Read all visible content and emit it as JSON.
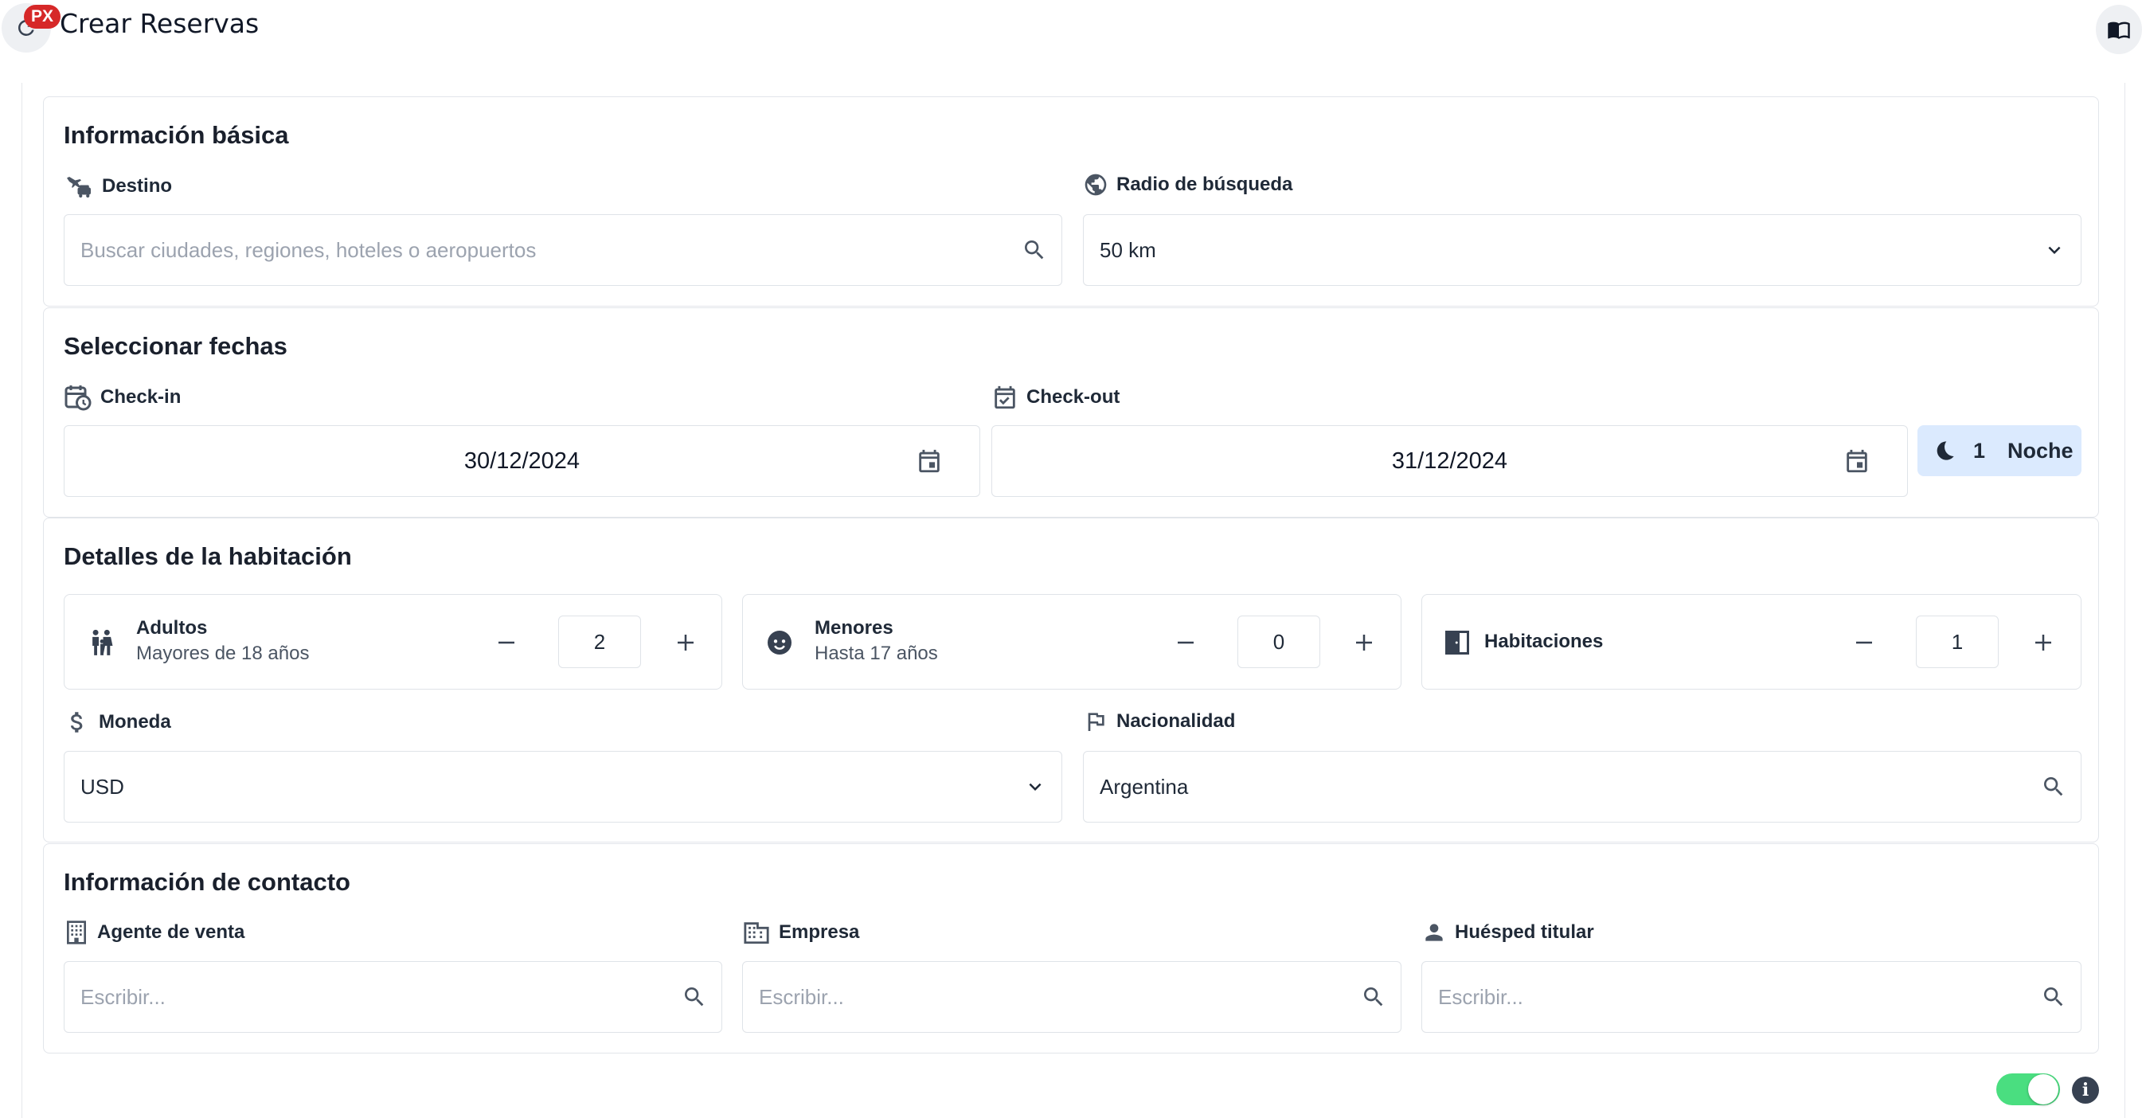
{
  "header": {
    "title": "Crear Reservas",
    "badge": "PX",
    "refresh_icon": "refresh-icon",
    "book_icon": "open-book-icon"
  },
  "basic_info": {
    "title": "Información básica",
    "destination": {
      "label": "Destino",
      "icon": "plane-car-icon",
      "placeholder": "Buscar ciudades, regiones, hoteles o aeropuertos",
      "value": ""
    },
    "radius": {
      "label": "Radio de búsqueda",
      "icon": "globe-icon",
      "value": "50 km"
    }
  },
  "dates": {
    "title": "Seleccionar fechas",
    "checkin": {
      "label": "Check-in",
      "value": "30/12/2024",
      "icon": "calendar-clock-icon"
    },
    "checkout": {
      "label": "Check-out",
      "value": "31/12/2024",
      "icon": "calendar-check-icon"
    },
    "nights": {
      "count": "1",
      "label": "Noche",
      "icon": "moon-icon"
    }
  },
  "room": {
    "title": "Detalles de la habitación",
    "adults": {
      "label": "Adultos",
      "sub": "Mayores de 18 años",
      "value": "2",
      "icon": "family-icon"
    },
    "minors": {
      "label": "Menores",
      "sub": "Hasta 17 años",
      "value": "0",
      "icon": "child-face-icon"
    },
    "rooms": {
      "label": "Habitaciones",
      "value": "1",
      "icon": "door-icon"
    },
    "currency": {
      "label": "Moneda",
      "value": "USD",
      "icon": "dollar-icon"
    },
    "nationality": {
      "label": "Nacionalidad",
      "value": "Argentina",
      "icon": "flag-icon"
    }
  },
  "contact": {
    "title": "Información de contacto",
    "agent": {
      "label": "Agente de venta",
      "placeholder": "Escribir...",
      "icon": "building-icon"
    },
    "company": {
      "label": "Empresa",
      "placeholder": "Escribir...",
      "icon": "office-icon"
    },
    "guest": {
      "label": "Huésped titular",
      "placeholder": "Escribir...",
      "icon": "person-icon"
    }
  },
  "footer": {
    "toggle_on": true,
    "info_glyph": "i"
  },
  "colors": {
    "accent_bg": "#dbeafe",
    "toggle": "#4ade80",
    "badge": "#d62828"
  }
}
